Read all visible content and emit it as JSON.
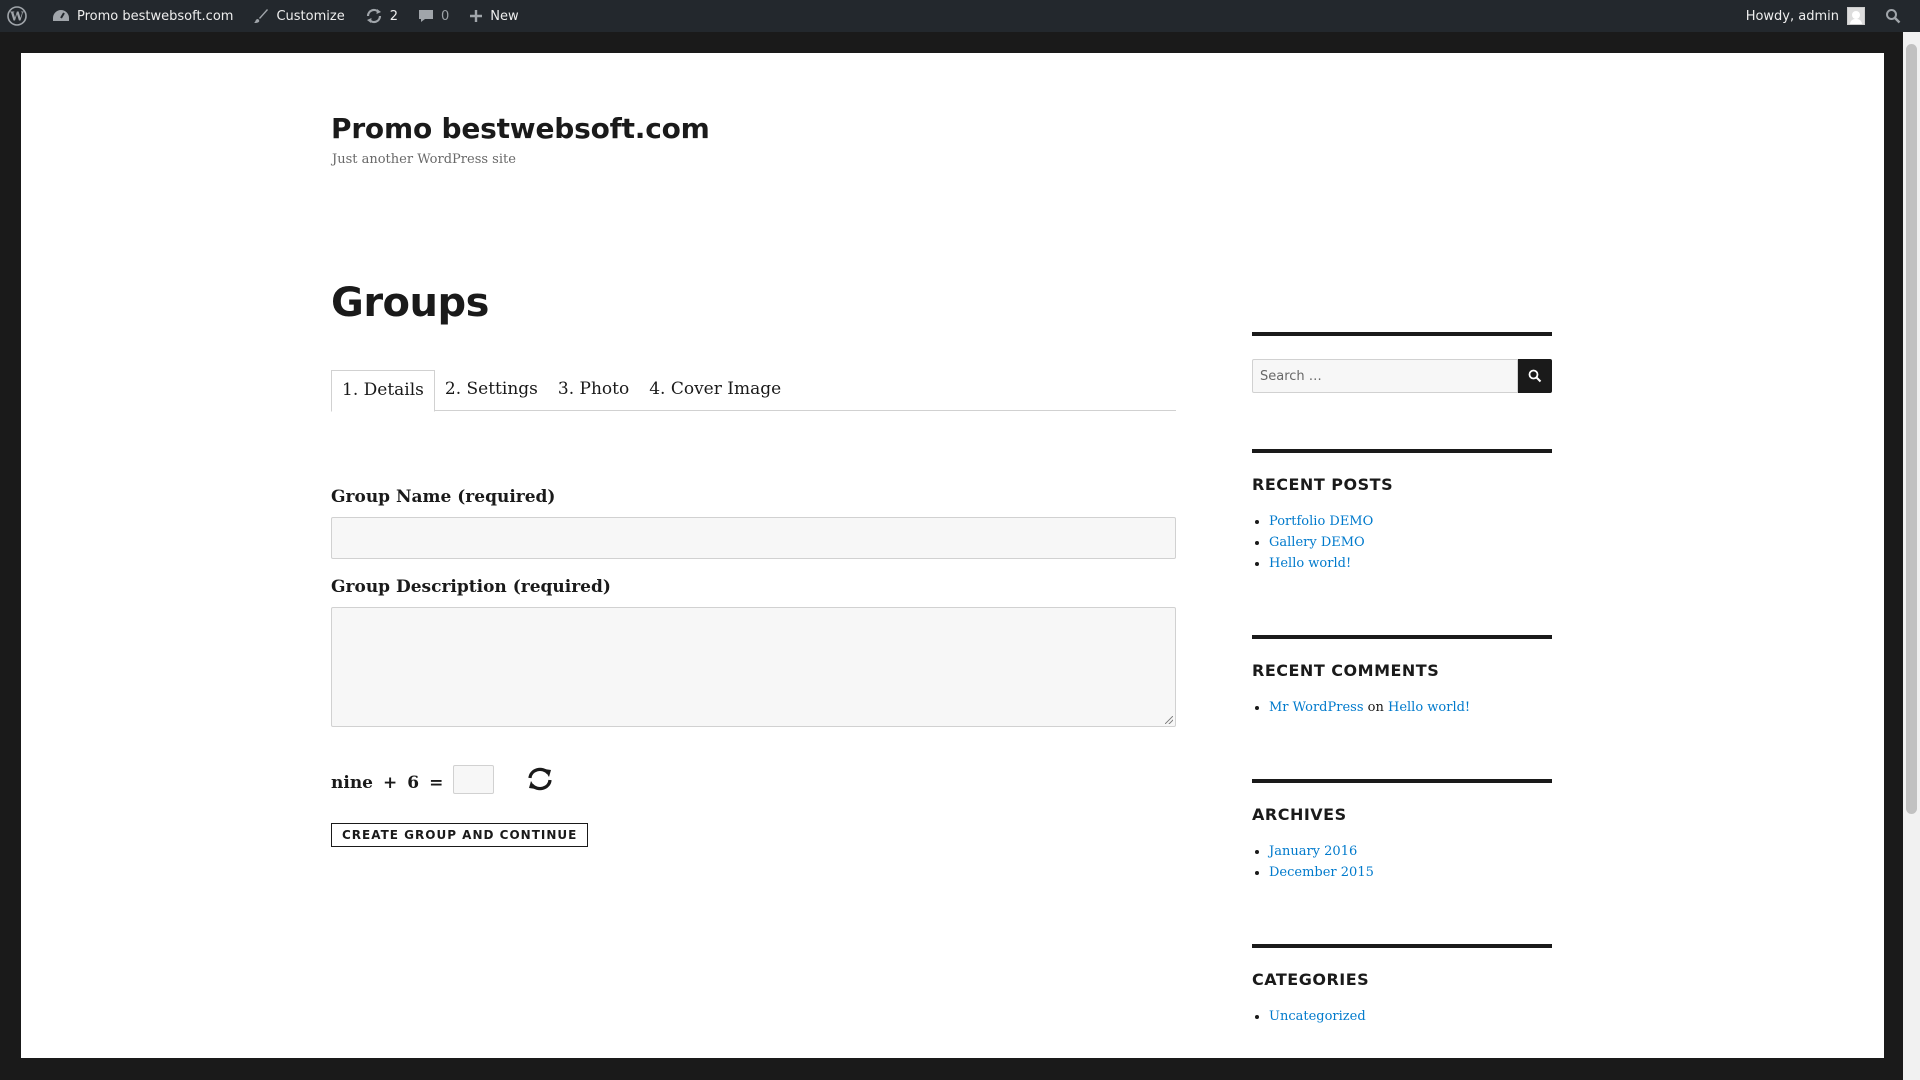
{
  "adminbar": {
    "site_name": "Promo bestwebsoft.com",
    "customize": "Customize",
    "updates_count": "2",
    "comments_count": "0",
    "new_label": "New",
    "howdy": "Howdy, admin"
  },
  "site": {
    "title": "Promo bestwebsoft.com",
    "description": "Just another WordPress site"
  },
  "main": {
    "title": "Groups",
    "tabs": [
      {
        "label": "1. Details"
      },
      {
        "label": "2. Settings"
      },
      {
        "label": "3. Photo"
      },
      {
        "label": "4. Cover Image"
      }
    ],
    "group_name_label": "Group Name (required)",
    "group_name_value": "",
    "group_desc_label": "Group Description (required)",
    "group_desc_value": "",
    "captcha": {
      "a": "nine",
      "op": "+",
      "b": "6",
      "eq": "=",
      "value": ""
    },
    "submit_label": "CREATE GROUP AND CONTINUE"
  },
  "sidebar": {
    "search_placeholder": "Search …",
    "recent_posts": {
      "title": "RECENT POSTS",
      "items": [
        "Portfolio DEMO",
        "Gallery DEMO",
        "Hello world!"
      ]
    },
    "recent_comments": {
      "title": "RECENT COMMENTS",
      "author": "Mr WordPress",
      "on": "on",
      "post": "Hello world!"
    },
    "archives": {
      "title": "ARCHIVES",
      "items": [
        "January 2016",
        "December 2015"
      ]
    },
    "categories": {
      "title": "CATEGORIES",
      "items": [
        "Uncategorized"
      ]
    }
  },
  "colors": {
    "adminbar_bg": "#23282d",
    "link": "#007acc",
    "text": "#1a1a1a",
    "frame": "#1a1a1a"
  }
}
